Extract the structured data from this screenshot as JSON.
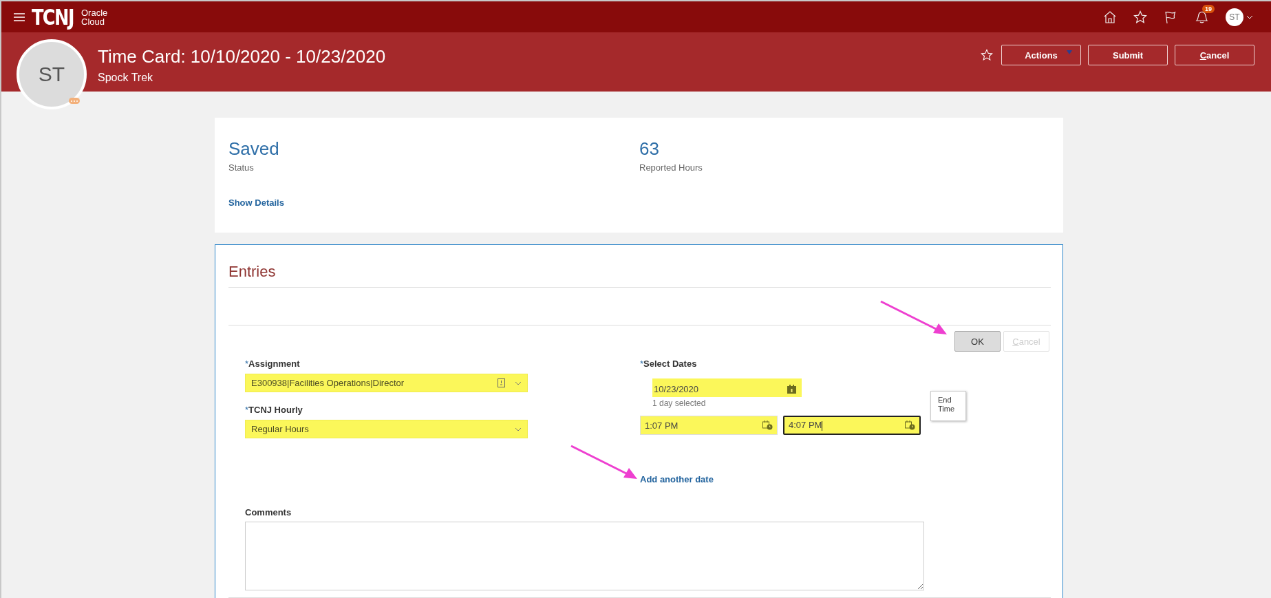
{
  "top_bar": {
    "logo": "TCNJ",
    "logo_sub": "Oracle Cloud",
    "notification_count": "19",
    "user_initials": "ST"
  },
  "header": {
    "avatar_initials": "ST",
    "title": "Time Card: 10/10/2020 - 10/23/2020",
    "subtitle": "Spock Trek",
    "buttons": [
      {
        "label": "Actions",
        "kind": "menu"
      },
      {
        "label": "Submit",
        "kind": "plain"
      },
      {
        "label": "Cancel",
        "kind": "plain"
      }
    ]
  },
  "summary": {
    "items": [
      {
        "value": "Saved",
        "label": "Status"
      },
      {
        "value": "63",
        "label": "Reported Hours"
      }
    ],
    "link": "Show Details"
  },
  "entries": {
    "title": "Entries",
    "buttons": [
      {
        "label": "OK",
        "disabled": false
      },
      {
        "label": "Cancel",
        "disabled": true
      }
    ],
    "assignment": {
      "label": "Assignment",
      "required_mark": "*",
      "value": "E300938|Facilities Operations|Director",
      "highlighted": true
    },
    "hourly": {
      "label": "TCNJ Hourly",
      "required_mark": "*",
      "value": "Regular Hours",
      "highlighted": true
    },
    "dates": {
      "label": "Select Dates",
      "required_mark": "*",
      "value": "10/23/2020",
      "note": "1 day selected",
      "highlighted": true
    },
    "times": [
      {
        "value": "1:07 PM",
        "focused": false,
        "highlighted": true
      },
      {
        "value": "4:07 PM",
        "focused": true,
        "highlighted": true
      }
    ],
    "tooltip": "End Time",
    "add_link": "Add another date",
    "comments": {
      "label": "Comments"
    }
  }
}
